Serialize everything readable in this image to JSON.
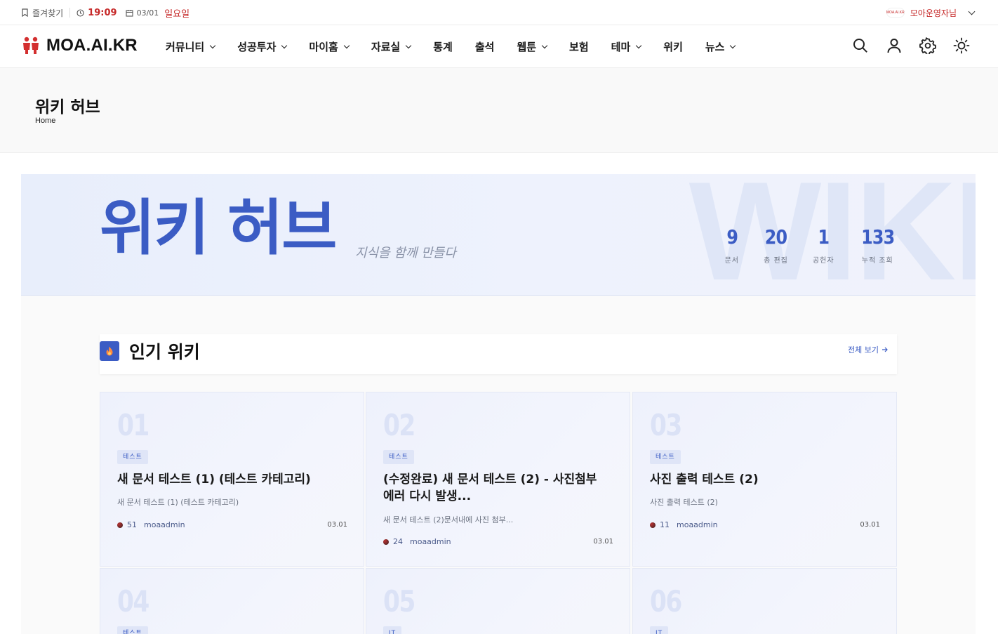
{
  "topbar": {
    "bookmark_label": "즐겨찾기",
    "time": "19:09",
    "date": "03/01",
    "day": "일요일",
    "user_label": "모아운영자님",
    "logo_text": "MOA.AI.KR"
  },
  "header": {
    "brand": "MOA.AI.KR",
    "nav": [
      {
        "label": "커뮤니티",
        "dropdown": true
      },
      {
        "label": "성공투자",
        "dropdown": true
      },
      {
        "label": "마이홈",
        "dropdown": true
      },
      {
        "label": "자료실",
        "dropdown": true
      },
      {
        "label": "통계",
        "dropdown": false
      },
      {
        "label": "출석",
        "dropdown": false
      },
      {
        "label": "웹툰",
        "dropdown": true
      },
      {
        "label": "보험",
        "dropdown": false
      },
      {
        "label": "테마",
        "dropdown": true
      },
      {
        "label": "위키",
        "dropdown": false
      },
      {
        "label": "뉴스",
        "dropdown": true
      }
    ],
    "icons": [
      "search-icon",
      "user-icon",
      "gear-icon",
      "sun-icon"
    ]
  },
  "page": {
    "title": "위키 허브",
    "breadcrumb": "Home"
  },
  "hero": {
    "title": "위키 허브",
    "subtitle": "지식을 함께 만들다",
    "bg_text": "WIKI",
    "stats": [
      {
        "value": "9",
        "label": "문서"
      },
      {
        "value": "20",
        "label": "총 편집"
      },
      {
        "value": "1",
        "label": "공헌자"
      },
      {
        "value": "133",
        "label": "누적 조회"
      }
    ]
  },
  "popular": {
    "title": "인기 위키",
    "more_label": "전체 보기",
    "cards": [
      {
        "num": "01",
        "tag": "테스트",
        "title": "새 문서 테스트 (1) (테스트 카테고리)",
        "excerpt": "새 문서 테스트 (1) (테스트 카테고리)",
        "views": "51",
        "author": "moaadmin",
        "date": "03.01"
      },
      {
        "num": "02",
        "tag": "테스트",
        "title": "(수정완료) 새 문서 테스트 (2) - 사진첨부 에러 다시 발생...",
        "excerpt": "새 문서 테스트 (2)문서내에 사진 첨부...",
        "views": "24",
        "author": "moaadmin",
        "date": "03.01"
      },
      {
        "num": "03",
        "tag": "테스트",
        "title": "사진 출력 테스트 (2)",
        "excerpt": "사진 출력 테스트 (2)",
        "views": "11",
        "author": "moaadmin",
        "date": "03.01"
      },
      {
        "num": "04",
        "tag": "테스트"
      },
      {
        "num": "05",
        "tag": "IT"
      },
      {
        "num": "06",
        "tag": "IT"
      }
    ]
  },
  "colors": {
    "accent": "#3b5cc4",
    "brand_red": "#c62828"
  }
}
